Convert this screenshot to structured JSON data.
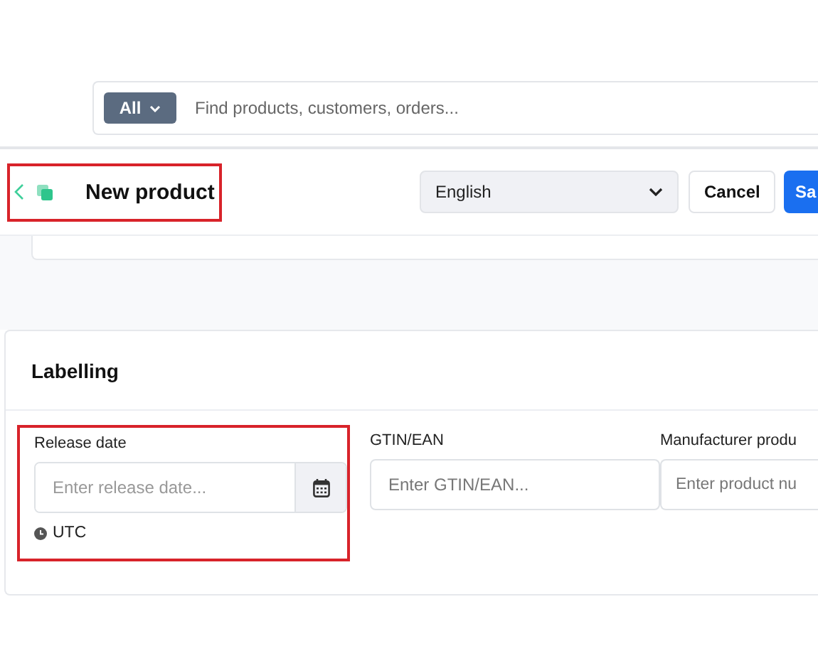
{
  "search": {
    "scope": "All",
    "placeholder": "Find products, customers, orders..."
  },
  "header": {
    "title": "New product",
    "highlighted": true,
    "language": "English",
    "buttons": [
      {
        "label": "Cancel",
        "kind": "secondary"
      },
      {
        "label": "Sa",
        "kind": "primary"
      }
    ]
  },
  "labelling": {
    "title": "Labelling",
    "fields": [
      {
        "label": "Release date",
        "placeholder": "Enter release date...",
        "kind": "date",
        "timezone": "UTC",
        "highlighted": true
      },
      {
        "label": "GTIN/EAN",
        "placeholder": "Enter GTIN/EAN...",
        "kind": "text",
        "highlighted": false
      },
      {
        "label": "Manufacturer produ",
        "placeholder": "Enter product nu",
        "kind": "text",
        "highlighted": false
      }
    ]
  }
}
